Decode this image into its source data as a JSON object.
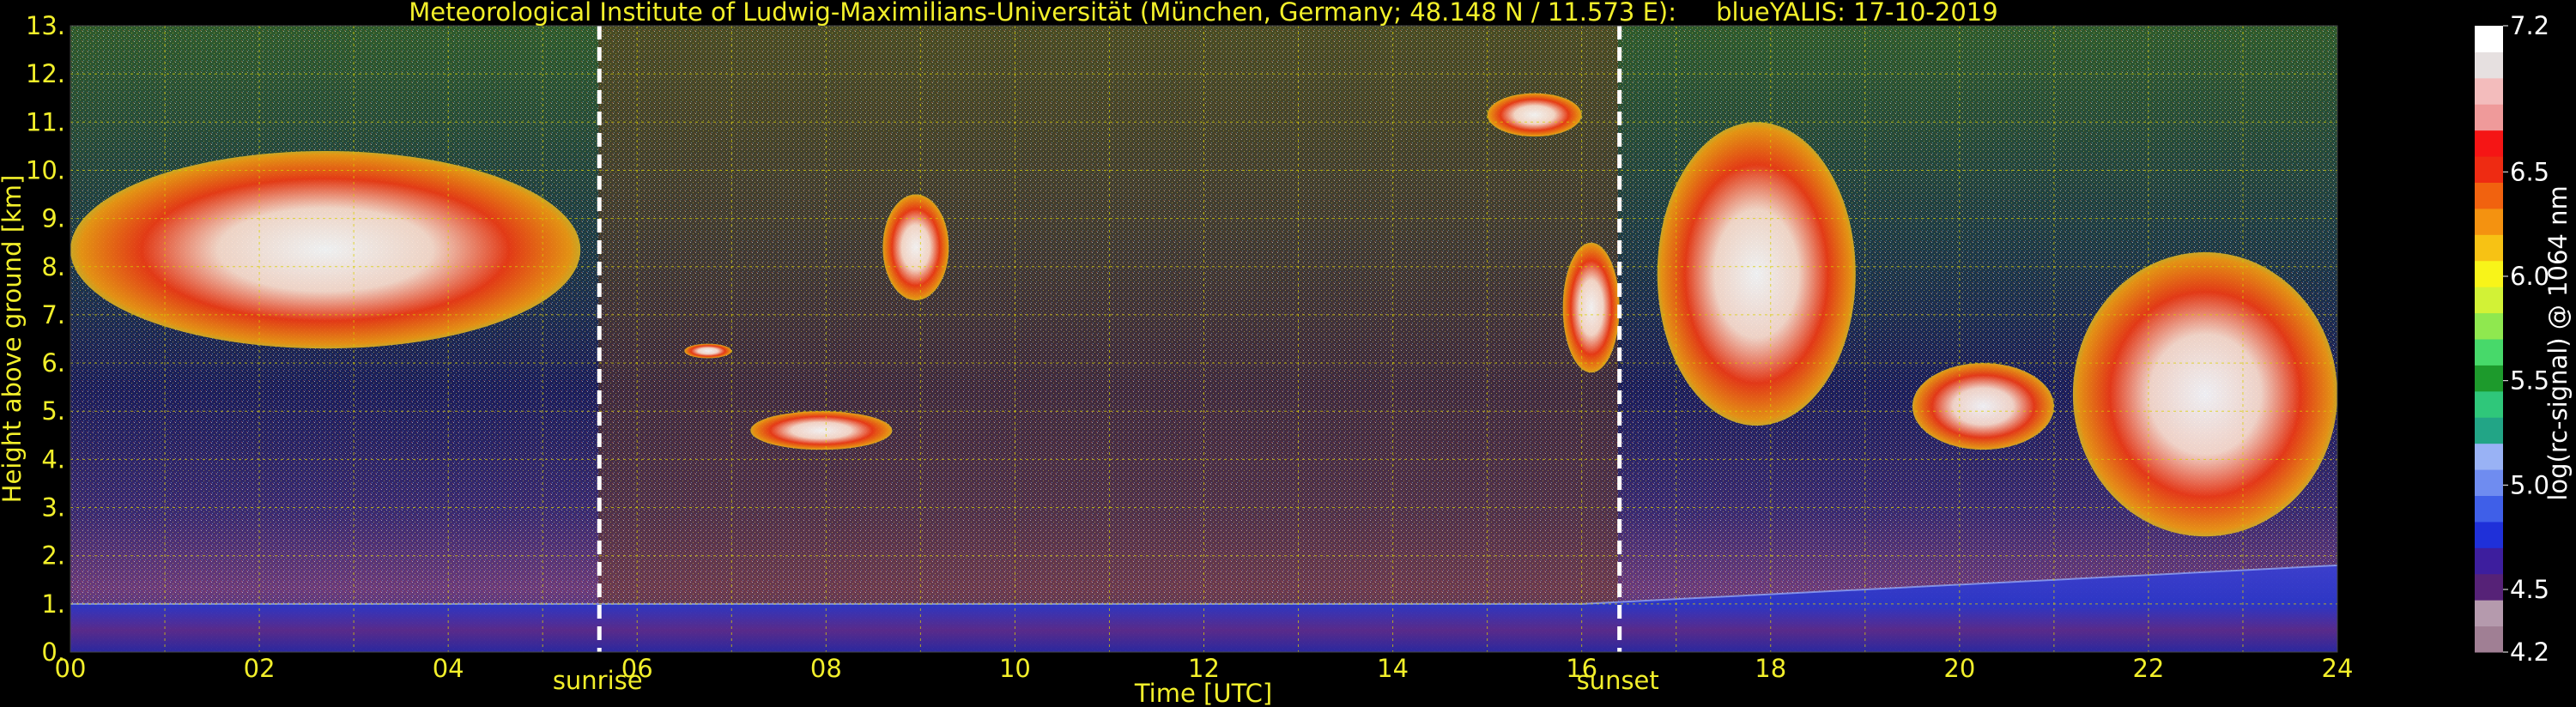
{
  "chart_data": {
    "type": "heatmap",
    "title": "Meteorological Institute of Ludwig-Maximilians-Universität (München, Germany; 48.148 N / 11.573 E):     blueYALIS: 17-10-2019",
    "xlabel": "Time [UTC]",
    "ylabel": "Height above ground [km]",
    "xlim": [
      0,
      24
    ],
    "ylim": [
      0,
      13
    ],
    "xticks": [
      "00",
      "02",
      "04",
      "06",
      "08",
      "10",
      "12",
      "14",
      "16",
      "18",
      "20",
      "22",
      "24"
    ],
    "yticks": [
      "0.",
      "1.",
      "2.",
      "3.",
      "4.",
      "5.",
      "6.",
      "7.",
      "8.",
      "9.",
      "10.",
      "11.",
      "12.",
      "13."
    ],
    "grid": true,
    "annotations": [
      {
        "label": "sunrise",
        "x": 5.6
      },
      {
        "label": "sunset",
        "x": 16.4
      }
    ],
    "colorbar": {
      "label": "log(rc-signal) @ 1064 nm",
      "range": [
        4.2,
        7.2
      ],
      "ticks": [
        "4.2",
        "4.5",
        "5.0",
        "5.5",
        "6.0",
        "6.5",
        "7.2"
      ]
    },
    "cloud_layers": [
      {
        "t_start": 0.0,
        "t_end": 5.4,
        "base_km": 6.3,
        "top_km": 10.4
      },
      {
        "t_start": 6.5,
        "t_end": 7.0,
        "base_km": 6.1,
        "top_km": 6.4
      },
      {
        "t_start": 7.2,
        "t_end": 8.7,
        "base_km": 4.2,
        "top_km": 5.0
      },
      {
        "t_start": 8.6,
        "t_end": 9.3,
        "base_km": 7.3,
        "top_km": 9.5
      },
      {
        "t_start": 15.0,
        "t_end": 16.0,
        "base_km": 10.7,
        "top_km": 11.6
      },
      {
        "t_start": 15.8,
        "t_end": 16.4,
        "base_km": 5.8,
        "top_km": 8.5
      },
      {
        "t_start": 16.8,
        "t_end": 18.9,
        "base_km": 4.7,
        "top_km": 11.0
      },
      {
        "t_start": 19.5,
        "t_end": 21.0,
        "base_km": 4.2,
        "top_km": 6.0
      },
      {
        "t_start": 21.2,
        "t_end": 24.0,
        "base_km": 2.4,
        "top_km": 8.3
      }
    ],
    "boundary_layer_top_km": [
      {
        "t": 0,
        "h": 1.0
      },
      {
        "t": 6,
        "h": 1.0
      },
      {
        "t": 9,
        "h": 1.0
      },
      {
        "t": 12,
        "h": 1.0
      },
      {
        "t": 16,
        "h": 1.0
      },
      {
        "t": 24,
        "h": 1.8
      }
    ]
  },
  "colors": {
    "background": "#000000",
    "text_yellow": "#f2ef2a",
    "grid": "#d8d000",
    "marker_line": "#ffffff",
    "colorbar": [
      "#a07f94",
      "#b59aad",
      "#562277",
      "#3d1e9e",
      "#1f30d9",
      "#3f5fe8",
      "#6f8cf0",
      "#99b2f5",
      "#22a586",
      "#2fc77a",
      "#1d9a2c",
      "#47d96a",
      "#8fe84f",
      "#d2f236",
      "#f8f419",
      "#f7c214",
      "#f49210",
      "#f1620f",
      "#ee2b12",
      "#f51515",
      "#ef9a9a",
      "#f3bcbc",
      "#e6e0e0",
      "#ffffff"
    ]
  }
}
